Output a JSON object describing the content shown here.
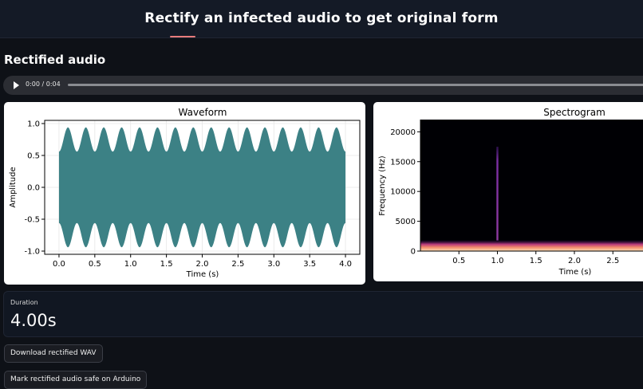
{
  "header": {
    "title": "Rectify an infected audio to get original form"
  },
  "section": {
    "title": "Rectified audio"
  },
  "audio": {
    "time": "0:00 / 0:04"
  },
  "metric": {
    "label": "Duration",
    "value": "4.00s"
  },
  "buttons": {
    "download": "Download rectified WAV",
    "mark_safe": "Mark rectified audio safe on Arduino"
  },
  "chart_data": [
    {
      "type": "area",
      "title": "Waveform",
      "xlabel": "Time (s)",
      "ylabel": "Amplitude",
      "xlim": [
        -0.2,
        4.2
      ],
      "ylim": [
        -1.05,
        1.05
      ],
      "xticks": [
        "0.0",
        "0.5",
        "1.0",
        "1.5",
        "2.0",
        "2.5",
        "3.0",
        "3.5",
        "4.0"
      ],
      "yticks": [
        "-1.0",
        "-0.5",
        "0.0",
        "0.5",
        "1.0"
      ],
      "grid": true,
      "fill_color": "#3c8185",
      "series": [
        {
          "envelope_center": 0.75,
          "envelope_swing": 0.19,
          "cycles_per_second": 4,
          "x_start": 0.0,
          "x_end": 4.0
        }
      ]
    },
    {
      "type": "heatmap",
      "title": "Spectrogram",
      "xlabel": "Time (s)",
      "ylabel": "Frequency (Hz)",
      "xticks": [
        "0.5",
        "1.0",
        "1.5",
        "2.0",
        "2.5"
      ],
      "yticks": [
        "0",
        "5000",
        "10000",
        "15000",
        "20000"
      ],
      "ylim": [
        0,
        22050
      ],
      "annotations": [
        {
          "kind": "spike",
          "time": 1.0,
          "freq_top": 17500,
          "color": "#7a2ea3"
        },
        {
          "kind": "low_band",
          "freq_top": 1800,
          "color": "#f0956a"
        }
      ]
    }
  ]
}
